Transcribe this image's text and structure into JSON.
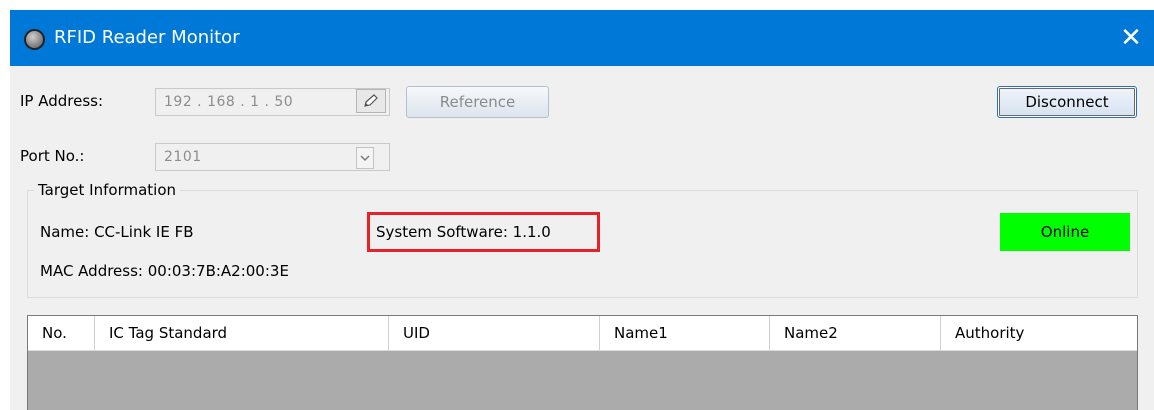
{
  "window": {
    "title": "RFID Reader Monitor",
    "close_glyph": "✕",
    "accent_color": "#0078d7"
  },
  "connection": {
    "ip_label": "IP Address:",
    "ip_value": "192 . 168 . 1 . 50",
    "reference_button": "Reference",
    "disconnect_button": "Disconnect",
    "port_label": "Port No.:",
    "port_value": "2101"
  },
  "target": {
    "group_label": "Target Information",
    "name_text": "Name: CC-Link IE FB",
    "system_software_text": "System Software:  1.1.0",
    "mac_text": "MAC Address:  00:03:7B:A2:00:3E",
    "status": "Online",
    "status_color": "#00ff00",
    "highlight_color": "#e8202a"
  },
  "table": {
    "columns": [
      "No.",
      "IC Tag Standard",
      "UID",
      "Name1",
      "Name2",
      "Authority"
    ],
    "rows": []
  },
  "icons": {
    "title": "app-status-icon",
    "edit": "pencil-icon",
    "dropdown": "chevron-down-icon",
    "close": "close-icon"
  }
}
